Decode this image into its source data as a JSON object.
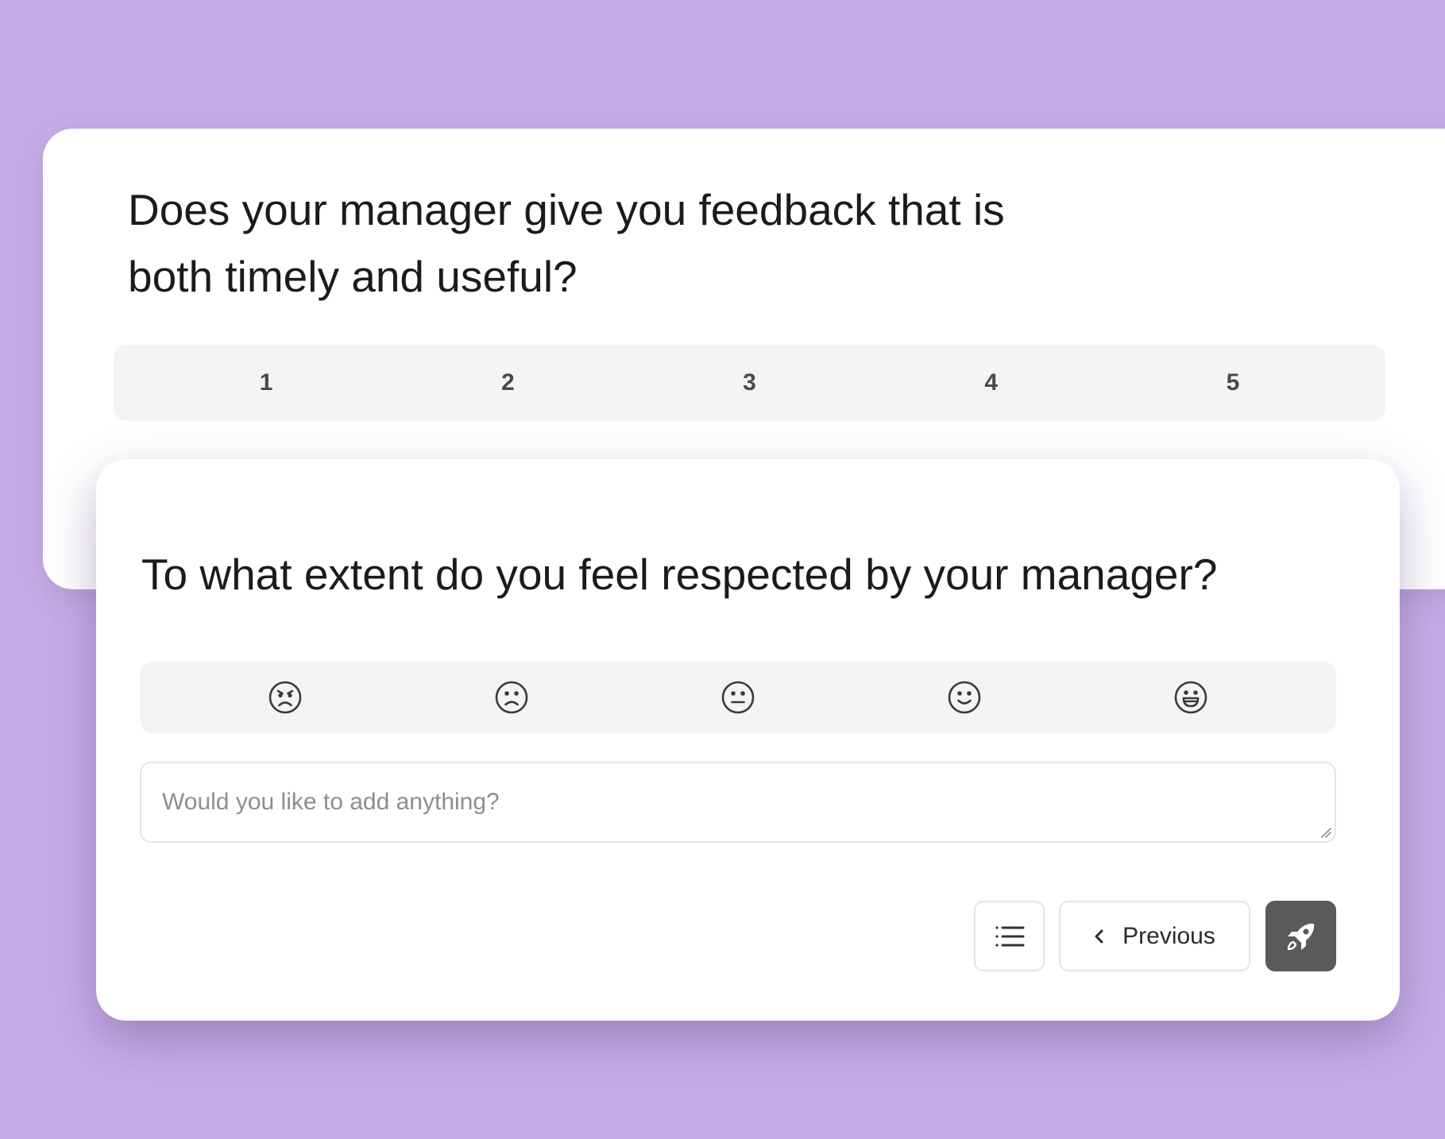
{
  "colors": {
    "background": "#c7aee6",
    "card": "#ffffff",
    "scale_background": "#f4f4f4",
    "submit_button": "#5a5a5a"
  },
  "question_1": {
    "title": "Does your manager give you feedback that is both timely and useful?",
    "options": [
      "1",
      "2",
      "3",
      "4",
      "5"
    ]
  },
  "question_2": {
    "title": "To what extent do you feel respected by your manager?",
    "emoji_options": [
      "angry-face-icon",
      "sad-face-icon",
      "neutral-face-icon",
      "smiling-face-icon",
      "grinning-face-icon"
    ],
    "comment_placeholder": "Would you like to add anything?",
    "comment_value": ""
  },
  "navigation": {
    "list_icon": "list-icon",
    "previous_label": "Previous",
    "previous_icon": "chevron-left-icon",
    "submit_icon": "rocket-icon"
  }
}
